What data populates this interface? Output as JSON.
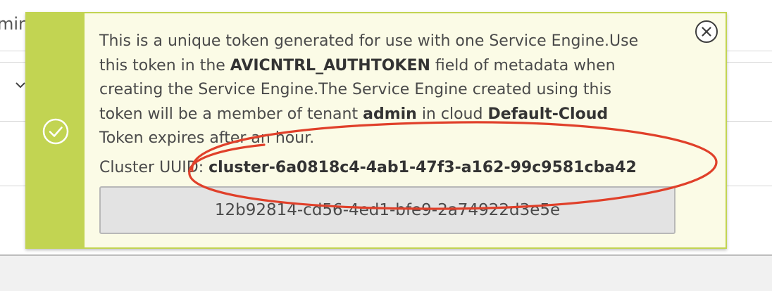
{
  "background": {
    "partial_text": "mir"
  },
  "notification": {
    "message_parts": {
      "p1": "This is a unique token generated for use with one Service Engine.Use this token in the ",
      "field_name": "AVICNTRL_AUTHTOKEN",
      "p2": " field of metadata when creating the Service Engine.The Service Engine created using this token will be a member of tenant ",
      "tenant": "admin",
      "p3": " in cloud ",
      "cloud": "Default-Cloud",
      "p4": " Token expires after an hour."
    },
    "cluster_uuid_label": "Cluster UUID: ",
    "cluster_uuid": "cluster-6a0818c4-4ab1-47f3-a162-99c9581cba42",
    "token": "12b92814-cd56-4ed1-bfe9-2a74922d3e5e",
    "status_icon": "check-circle-icon",
    "close_icon": "close-circle-icon"
  },
  "colors": {
    "accent": "#c2d452",
    "notification_bg": "#fbfbe6",
    "annotation": "#e0402a",
    "token_box_bg": "#e3e3e3"
  }
}
